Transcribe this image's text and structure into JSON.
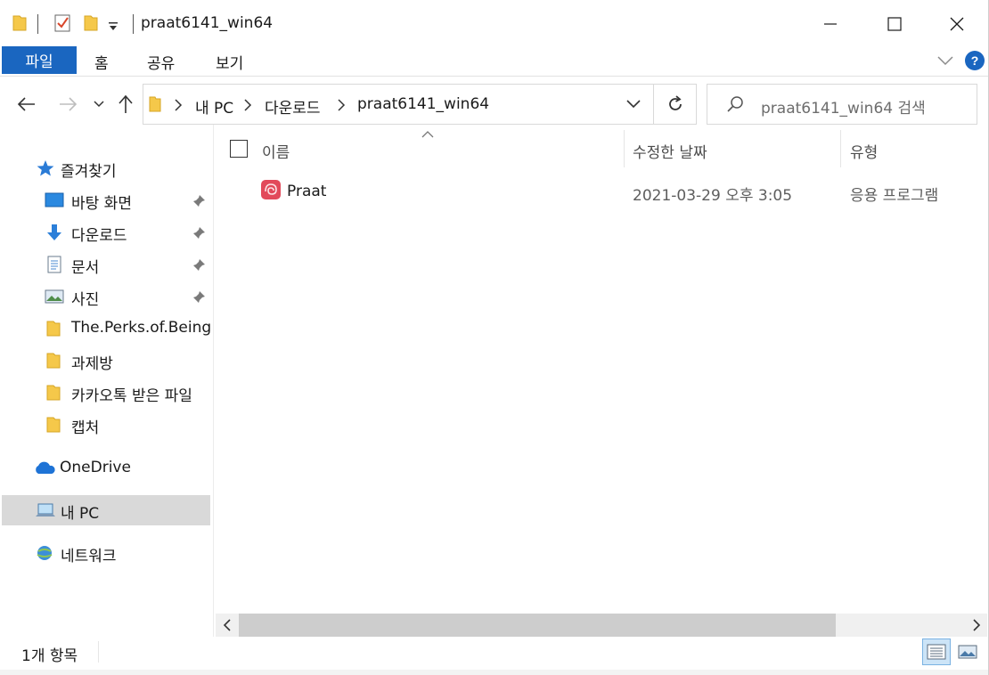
{
  "window": {
    "title": "praat6141_win64"
  },
  "ribbon": {
    "tabs": [
      "파일",
      "홈",
      "공유",
      "보기"
    ],
    "help_label": "?"
  },
  "navigation": {
    "breadcrumbs": [
      "내 PC",
      "다운로드",
      "praat6141_win64"
    ],
    "search_placeholder": "praat6141_win64 검색"
  },
  "sidebar": {
    "quick_access_label": "즐겨찾기",
    "items": [
      {
        "label": "바탕 화면",
        "icon": "desktop-icon",
        "pinned": true
      },
      {
        "label": "다운로드",
        "icon": "download-arrow-icon",
        "pinned": true
      },
      {
        "label": "문서",
        "icon": "document-icon",
        "pinned": true
      },
      {
        "label": "사진",
        "icon": "pictures-icon",
        "pinned": true
      },
      {
        "label": "The.Perks.of.Being.a",
        "icon": "folder-icon",
        "pinned": false
      },
      {
        "label": "과제방",
        "icon": "folder-icon",
        "pinned": false
      },
      {
        "label": "카카오톡 받은 파일",
        "icon": "folder-icon",
        "pinned": false
      },
      {
        "label": "캡처",
        "icon": "folder-icon",
        "pinned": false
      }
    ],
    "onedrive_label": "OneDrive",
    "this_pc_label": "내 PC",
    "network_label": "네트워크"
  },
  "file_list": {
    "columns": [
      "이름",
      "수정한 날짜",
      "유형"
    ],
    "rows": [
      {
        "name": "Praat",
        "modified": "2021-03-29 오후 3:05",
        "type": "응용 프로그램",
        "icon": "praat-app-icon"
      }
    ]
  },
  "status": {
    "item_count": "1개 항목"
  },
  "colors": {
    "accent": "#1a66c0",
    "folder": "#f5c84a",
    "selected_bg": "#d9d9d9"
  }
}
